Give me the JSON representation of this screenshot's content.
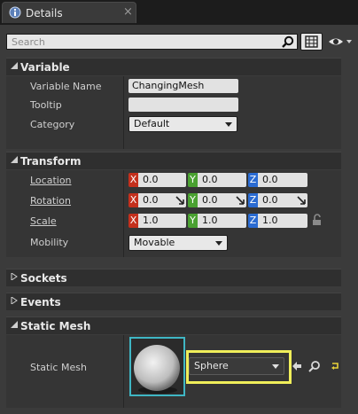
{
  "tab": {
    "title": "Details"
  },
  "search": {
    "placeholder": "Search"
  },
  "sections": {
    "variable": {
      "title": "Variable",
      "rows": {
        "name_label": "Variable Name",
        "name_value": "ChangingMesh",
        "tooltip_label": "Tooltip",
        "tooltip_value": "",
        "category_label": "Category",
        "category_value": "Default"
      }
    },
    "transform": {
      "title": "Transform",
      "location": {
        "label": "Location",
        "x": "0.0",
        "y": "0.0",
        "z": "0.0"
      },
      "rotation": {
        "label": "Rotation",
        "x": "0.0",
        "y": "0.0",
        "z": "0.0"
      },
      "scale": {
        "label": "Scale",
        "x": "1.0",
        "y": "1.0",
        "z": "1.0"
      },
      "mobility": {
        "label": "Mobility",
        "value": "Movable"
      },
      "axis_labels": {
        "x": "X",
        "y": "Y",
        "z": "Z"
      }
    },
    "sockets": {
      "title": "Sockets"
    },
    "events": {
      "title": "Events"
    },
    "static_mesh": {
      "title": "Static Mesh",
      "label": "Static Mesh",
      "value": "Sphere"
    }
  },
  "colors": {
    "axis_x": "#c4301d",
    "axis_y": "#4aa131",
    "axis_z": "#2a6bd2",
    "highlight": "#f0ee5a",
    "thumbnail_border": "#3fb6c4"
  }
}
